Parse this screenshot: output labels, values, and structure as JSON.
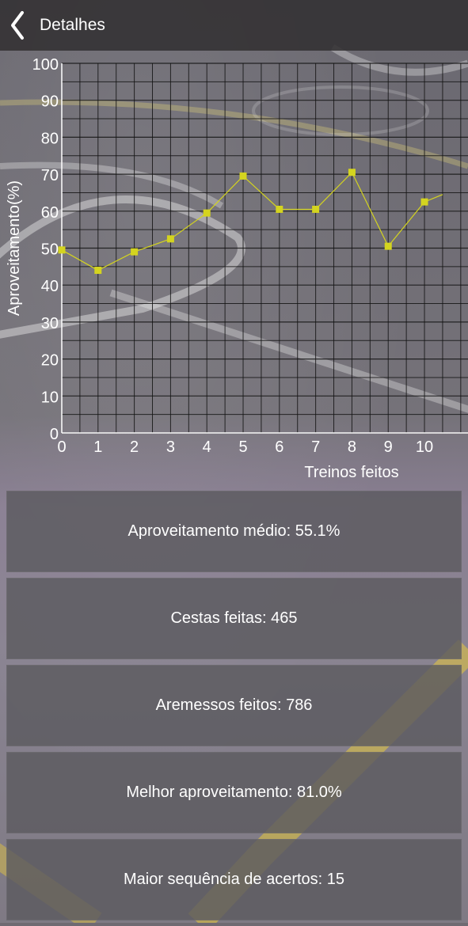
{
  "header": {
    "title": "Detalhes"
  },
  "chart_data": {
    "type": "line",
    "xlabel": "Treinos feitos",
    "ylabel": "Aproveitamento(%)",
    "x": [
      0,
      1,
      2,
      3,
      4,
      5,
      6,
      7,
      8,
      9,
      10,
      10.5
    ],
    "values": [
      49.5,
      44,
      49,
      52.5,
      59.5,
      69.5,
      60.5,
      60.5,
      70.5,
      50.5,
      62.5,
      64.5
    ],
    "xlim": [
      0,
      10.5
    ],
    "ylim": [
      0,
      100
    ],
    "x_ticks": [
      "0",
      "1",
      "2",
      "3",
      "4",
      "5",
      "6",
      "7",
      "8",
      "9",
      "10"
    ],
    "y_ticks": [
      "0",
      "10",
      "20",
      "30",
      "40",
      "50",
      "60",
      "70",
      "80",
      "90",
      "100"
    ],
    "grid": true,
    "line_color": "#d4d41f",
    "marker_color": "#d4d41f"
  },
  "stats": {
    "avg_label": "Aproveitamento médio: 55.1%",
    "baskets_label": "Cestas feitas: 465",
    "shots_label": "Aremessos feitos: 786",
    "best_label": "Melhor aproveitamento: 81.0%",
    "streak_label": "Maior sequência de acertos: 15"
  }
}
